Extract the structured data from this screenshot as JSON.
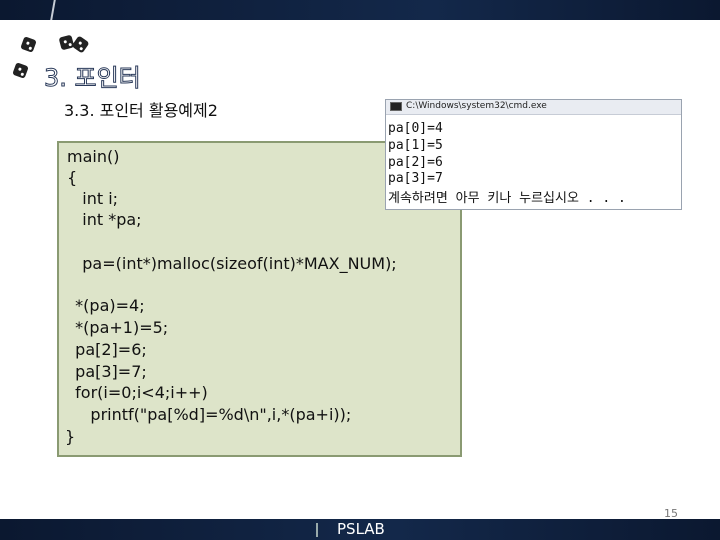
{
  "slide": {
    "section_title": "3. 포인터",
    "subtitle": "3.3. 포인터 활용예제2",
    "page_number": "15",
    "footer_label": "PSLAB"
  },
  "code": {
    "lines": [
      "main()",
      "{",
      "   int i;",
      "   int *pa;",
      "   pa=(int*)malloc(sizeof(int)*MAX_NUM);",
      "  *(pa)=4;",
      "  *(pa+1)=5;",
      "  pa[2]=6;",
      "  pa[3]=7;",
      "  for(i=0;i<4;i++)",
      "     printf(\"pa[%d]=%d\\n\",i,*(pa+i));",
      "}"
    ]
  },
  "console": {
    "title": "C:\\Windows\\system32\\cmd.exe",
    "output": [
      "pa[0]=4",
      "pa[1]=5",
      "pa[2]=6",
      "pa[3]=7",
      "계속하려면 아무 키나 누르십시오 . . ."
    ]
  }
}
